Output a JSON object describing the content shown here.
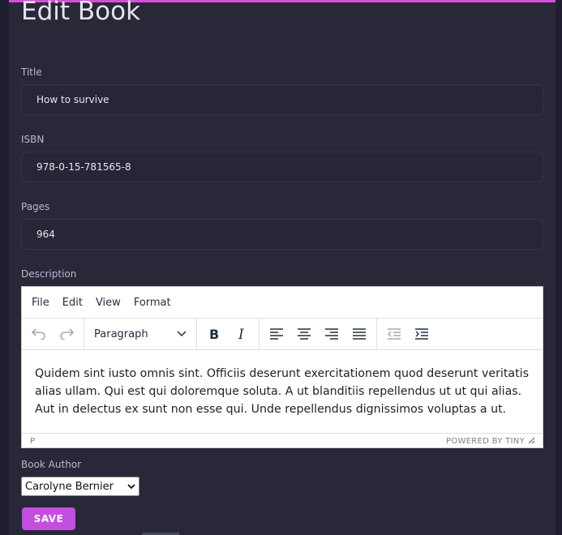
{
  "page": {
    "title": "Edit Book"
  },
  "form": {
    "title_label": "Title",
    "title_value": "How to survive",
    "isbn_label": "ISBN",
    "isbn_value": "978-0-15-781565-8",
    "pages_label": "Pages",
    "pages_value": "964",
    "description_label": "Description",
    "author_label": "Book Author",
    "author_value": "Carolyne Bernier",
    "save_label": "SAVE"
  },
  "editor": {
    "menu": [
      "File",
      "Edit",
      "View",
      "Format"
    ],
    "block_format": "Paragraph",
    "content": "Quidem sint iusto omnis sint. Officiis deserunt exercitationem quod deserunt veritatis alias ullam. Qui est qui doloremque soluta. A ut blanditiis repellendus ut ut qui alias. Aut in delectus ex sunt non esse qui. Unde repellendus dignissimos voluptas a ut.",
    "path": "P",
    "branding": "POWERED BY TINY",
    "tools": [
      "undo-icon",
      "redo-icon",
      "bold-icon",
      "italic-icon",
      "align-left-icon",
      "align-center-icon",
      "align-right-icon",
      "align-justify-icon",
      "outdent-icon",
      "indent-icon"
    ]
  },
  "colors": {
    "accent": "#c44ee0",
    "top_bar": "#d64fd6",
    "background": "#282839"
  }
}
